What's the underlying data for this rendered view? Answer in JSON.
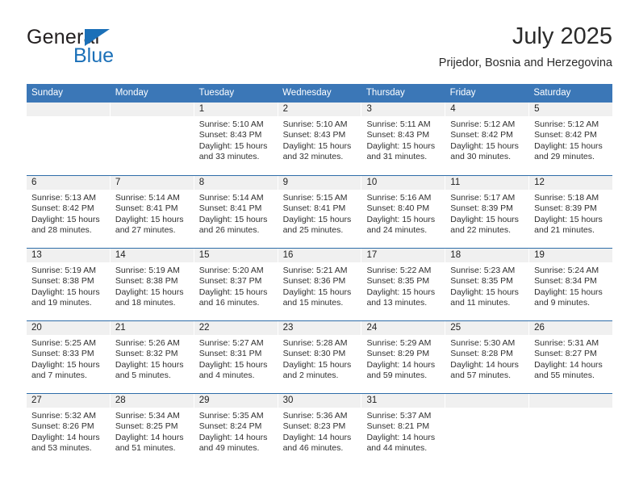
{
  "brand": {
    "name_primary": "General",
    "name_secondary": "Blue",
    "accent_color": "#1b70b8"
  },
  "header": {
    "month_title": "July 2025",
    "location": "Prijedor, Bosnia and Herzegovina"
  },
  "theme": {
    "header_row_color": "#3b77b7",
    "daynum_band_color": "#f0f0f0",
    "week_divider_color": "#2f6da9"
  },
  "weekday_headers": [
    "Sunday",
    "Monday",
    "Tuesday",
    "Wednesday",
    "Thursday",
    "Friday",
    "Saturday"
  ],
  "weeks": [
    [
      {
        "day": "",
        "sunrise": "",
        "sunset": "",
        "daylight": "",
        "empty": true
      },
      {
        "day": "",
        "sunrise": "",
        "sunset": "",
        "daylight": "",
        "empty": true
      },
      {
        "day": "1",
        "sunrise": "Sunrise: 5:10 AM",
        "sunset": "Sunset: 8:43 PM",
        "daylight": "Daylight: 15 hours and 33 minutes."
      },
      {
        "day": "2",
        "sunrise": "Sunrise: 5:10 AM",
        "sunset": "Sunset: 8:43 PM",
        "daylight": "Daylight: 15 hours and 32 minutes."
      },
      {
        "day": "3",
        "sunrise": "Sunrise: 5:11 AM",
        "sunset": "Sunset: 8:43 PM",
        "daylight": "Daylight: 15 hours and 31 minutes."
      },
      {
        "day": "4",
        "sunrise": "Sunrise: 5:12 AM",
        "sunset": "Sunset: 8:42 PM",
        "daylight": "Daylight: 15 hours and 30 minutes."
      },
      {
        "day": "5",
        "sunrise": "Sunrise: 5:12 AM",
        "sunset": "Sunset: 8:42 PM",
        "daylight": "Daylight: 15 hours and 29 minutes."
      }
    ],
    [
      {
        "day": "6",
        "sunrise": "Sunrise: 5:13 AM",
        "sunset": "Sunset: 8:42 PM",
        "daylight": "Daylight: 15 hours and 28 minutes."
      },
      {
        "day": "7",
        "sunrise": "Sunrise: 5:14 AM",
        "sunset": "Sunset: 8:41 PM",
        "daylight": "Daylight: 15 hours and 27 minutes."
      },
      {
        "day": "8",
        "sunrise": "Sunrise: 5:14 AM",
        "sunset": "Sunset: 8:41 PM",
        "daylight": "Daylight: 15 hours and 26 minutes."
      },
      {
        "day": "9",
        "sunrise": "Sunrise: 5:15 AM",
        "sunset": "Sunset: 8:41 PM",
        "daylight": "Daylight: 15 hours and 25 minutes."
      },
      {
        "day": "10",
        "sunrise": "Sunrise: 5:16 AM",
        "sunset": "Sunset: 8:40 PM",
        "daylight": "Daylight: 15 hours and 24 minutes."
      },
      {
        "day": "11",
        "sunrise": "Sunrise: 5:17 AM",
        "sunset": "Sunset: 8:39 PM",
        "daylight": "Daylight: 15 hours and 22 minutes."
      },
      {
        "day": "12",
        "sunrise": "Sunrise: 5:18 AM",
        "sunset": "Sunset: 8:39 PM",
        "daylight": "Daylight: 15 hours and 21 minutes."
      }
    ],
    [
      {
        "day": "13",
        "sunrise": "Sunrise: 5:19 AM",
        "sunset": "Sunset: 8:38 PM",
        "daylight": "Daylight: 15 hours and 19 minutes."
      },
      {
        "day": "14",
        "sunrise": "Sunrise: 5:19 AM",
        "sunset": "Sunset: 8:38 PM",
        "daylight": "Daylight: 15 hours and 18 minutes."
      },
      {
        "day": "15",
        "sunrise": "Sunrise: 5:20 AM",
        "sunset": "Sunset: 8:37 PM",
        "daylight": "Daylight: 15 hours and 16 minutes."
      },
      {
        "day": "16",
        "sunrise": "Sunrise: 5:21 AM",
        "sunset": "Sunset: 8:36 PM",
        "daylight": "Daylight: 15 hours and 15 minutes."
      },
      {
        "day": "17",
        "sunrise": "Sunrise: 5:22 AM",
        "sunset": "Sunset: 8:35 PM",
        "daylight": "Daylight: 15 hours and 13 minutes."
      },
      {
        "day": "18",
        "sunrise": "Sunrise: 5:23 AM",
        "sunset": "Sunset: 8:35 PM",
        "daylight": "Daylight: 15 hours and 11 minutes."
      },
      {
        "day": "19",
        "sunrise": "Sunrise: 5:24 AM",
        "sunset": "Sunset: 8:34 PM",
        "daylight": "Daylight: 15 hours and 9 minutes."
      }
    ],
    [
      {
        "day": "20",
        "sunrise": "Sunrise: 5:25 AM",
        "sunset": "Sunset: 8:33 PM",
        "daylight": "Daylight: 15 hours and 7 minutes."
      },
      {
        "day": "21",
        "sunrise": "Sunrise: 5:26 AM",
        "sunset": "Sunset: 8:32 PM",
        "daylight": "Daylight: 15 hours and 5 minutes."
      },
      {
        "day": "22",
        "sunrise": "Sunrise: 5:27 AM",
        "sunset": "Sunset: 8:31 PM",
        "daylight": "Daylight: 15 hours and 4 minutes."
      },
      {
        "day": "23",
        "sunrise": "Sunrise: 5:28 AM",
        "sunset": "Sunset: 8:30 PM",
        "daylight": "Daylight: 15 hours and 2 minutes."
      },
      {
        "day": "24",
        "sunrise": "Sunrise: 5:29 AM",
        "sunset": "Sunset: 8:29 PM",
        "daylight": "Daylight: 14 hours and 59 minutes."
      },
      {
        "day": "25",
        "sunrise": "Sunrise: 5:30 AM",
        "sunset": "Sunset: 8:28 PM",
        "daylight": "Daylight: 14 hours and 57 minutes."
      },
      {
        "day": "26",
        "sunrise": "Sunrise: 5:31 AM",
        "sunset": "Sunset: 8:27 PM",
        "daylight": "Daylight: 14 hours and 55 minutes."
      }
    ],
    [
      {
        "day": "27",
        "sunrise": "Sunrise: 5:32 AM",
        "sunset": "Sunset: 8:26 PM",
        "daylight": "Daylight: 14 hours and 53 minutes."
      },
      {
        "day": "28",
        "sunrise": "Sunrise: 5:34 AM",
        "sunset": "Sunset: 8:25 PM",
        "daylight": "Daylight: 14 hours and 51 minutes."
      },
      {
        "day": "29",
        "sunrise": "Sunrise: 5:35 AM",
        "sunset": "Sunset: 8:24 PM",
        "daylight": "Daylight: 14 hours and 49 minutes."
      },
      {
        "day": "30",
        "sunrise": "Sunrise: 5:36 AM",
        "sunset": "Sunset: 8:23 PM",
        "daylight": "Daylight: 14 hours and 46 minutes."
      },
      {
        "day": "31",
        "sunrise": "Sunrise: 5:37 AM",
        "sunset": "Sunset: 8:21 PM",
        "daylight": "Daylight: 14 hours and 44 minutes."
      },
      {
        "day": "",
        "sunrise": "",
        "sunset": "",
        "daylight": "",
        "empty": true
      },
      {
        "day": "",
        "sunrise": "",
        "sunset": "",
        "daylight": "",
        "empty": true
      }
    ]
  ]
}
